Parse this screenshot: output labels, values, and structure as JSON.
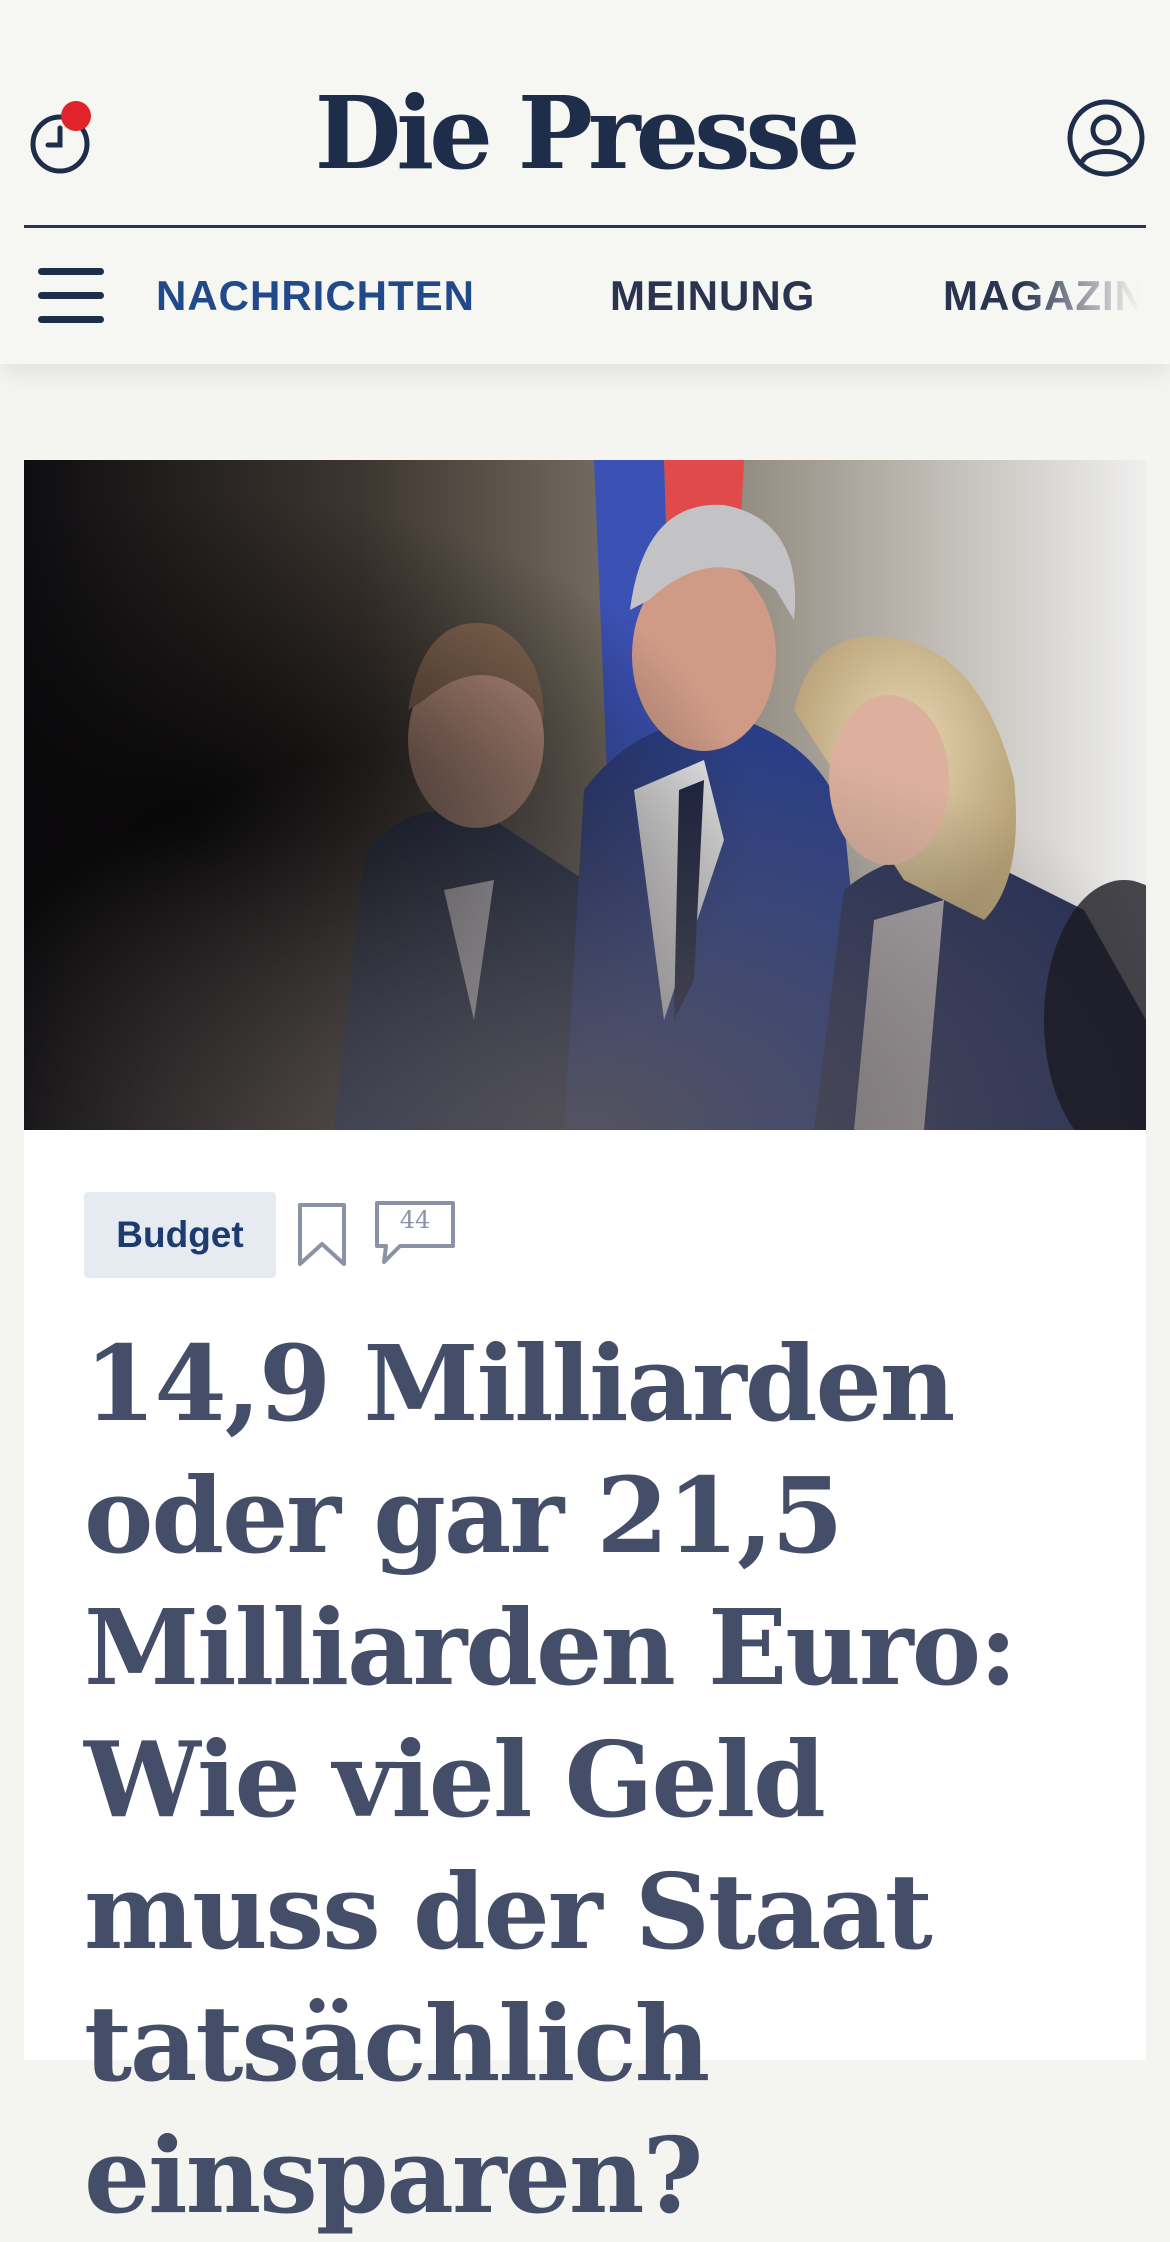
{
  "header": {
    "logo": "Die Presse",
    "history_icon": "clock-icon",
    "account_icon": "user-circle-icon",
    "notification_color": "#e1242c"
  },
  "nav": {
    "menu_icon": "hamburger-menu-icon",
    "items": [
      {
        "label": "NACHRICHTEN",
        "active": true
      },
      {
        "label": "MEINUNG",
        "active": false
      },
      {
        "label": "MAGAZIN",
        "active": false
      }
    ]
  },
  "article": {
    "tag": "Budget",
    "comment_count": "44",
    "headline": "14,9 Milliarden oder gar 21,5 Milliarden Euro: Wie viel Geld muss der Staat tatsächlich einsparen?"
  },
  "colors": {
    "brand": "#1e2d4a",
    "active_nav": "#214a8a",
    "headline": "#454e69",
    "tag_bg": "#e6ebf2"
  }
}
